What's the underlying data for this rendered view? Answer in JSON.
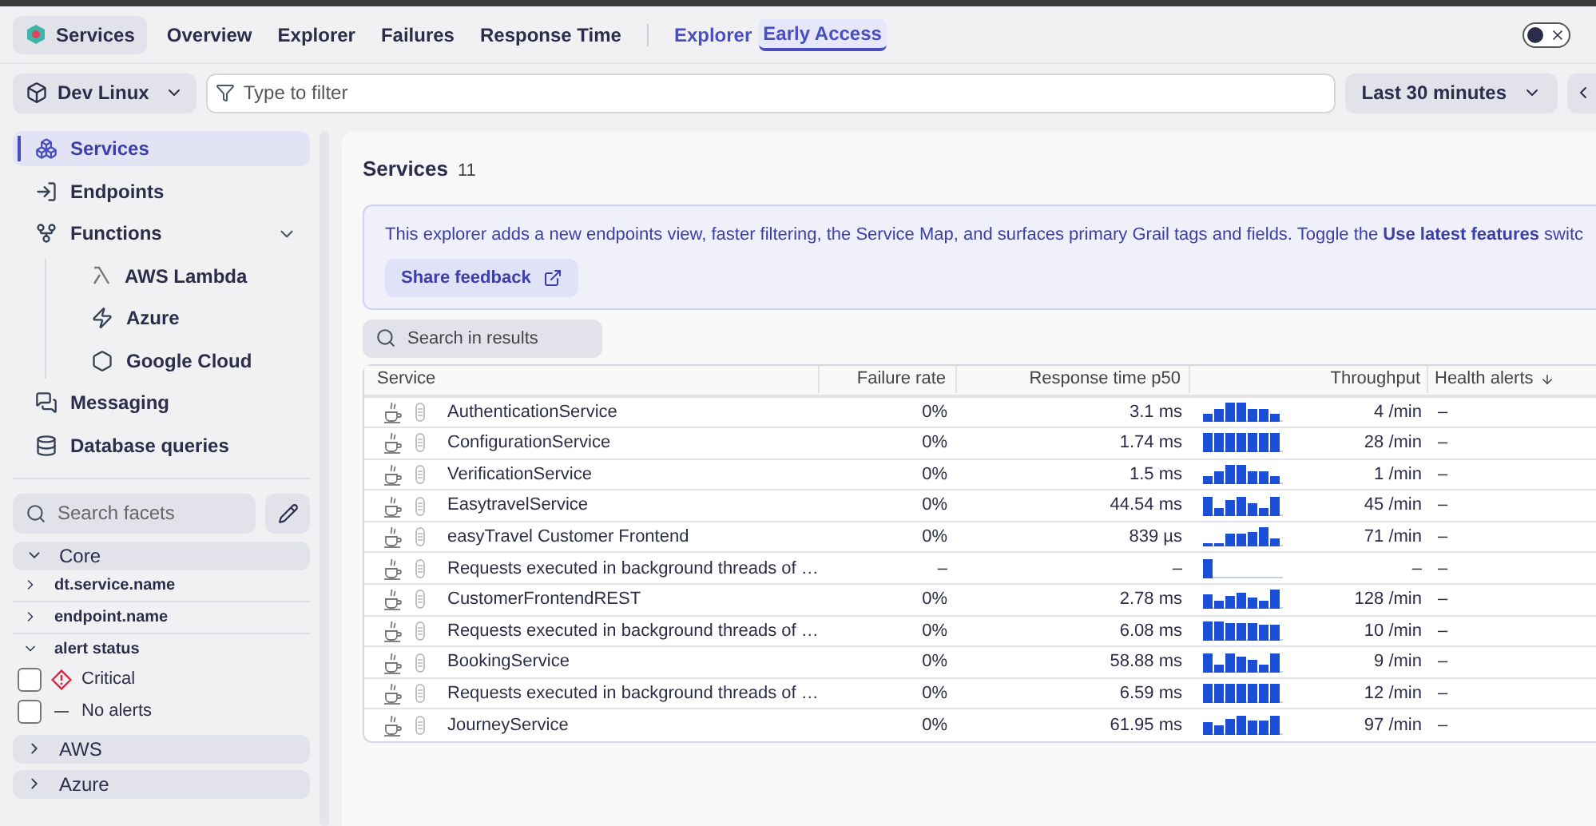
{
  "app_button": {
    "label": "Services"
  },
  "tabs": [
    {
      "label": "Overview",
      "selected": false
    },
    {
      "label": "Explorer",
      "selected": false
    },
    {
      "label": "Failures",
      "selected": false
    },
    {
      "label": "Response Time",
      "selected": false
    },
    {
      "label": "Explorer",
      "badge": "Early Access",
      "selected": true
    }
  ],
  "toggle": {
    "on": false
  },
  "filter_bar": {
    "environment": "Dev Linux",
    "placeholder": "Type to filter",
    "timeframe": "Last 30 minutes"
  },
  "sidebar": {
    "items": [
      {
        "label": "Services",
        "kind": "services",
        "selected": true
      },
      {
        "label": "Endpoints",
        "kind": "endpoints",
        "selected": false
      },
      {
        "label": "Functions",
        "kind": "functions",
        "selected": false,
        "expanded": true,
        "children": [
          {
            "label": "AWS Lambda",
            "kind": "lambda",
            "selected": false
          },
          {
            "label": "Azure",
            "kind": "azure",
            "selected": false
          },
          {
            "label": "Google Cloud",
            "kind": "gcloud",
            "selected": false
          }
        ]
      },
      {
        "label": "Messaging",
        "kind": "messaging",
        "selected": false
      },
      {
        "label": "Database queries",
        "kind": "database",
        "selected": false
      }
    ],
    "facet_search": {
      "placeholder": "Search facets"
    },
    "facet_groups": [
      {
        "label": "Core",
        "expanded": true,
        "facets": [
          {
            "label": "dt.service.name",
            "expanded": false
          },
          {
            "label": "endpoint.name",
            "expanded": false
          },
          {
            "label": "alert status",
            "expanded": true,
            "options": [
              {
                "label": "Critical",
                "kind": "critical",
                "checked": false
              },
              {
                "label": "No alerts",
                "kind": "none",
                "checked": false
              }
            ]
          }
        ]
      },
      {
        "label": "AWS",
        "expanded": false
      },
      {
        "label": "Azure",
        "expanded": false
      }
    ]
  },
  "main": {
    "title": "Services",
    "count": "11",
    "notice": {
      "text": "This explorer adds a new endpoints view, faster filtering, the Service Map, and surfaces primary Grail tags and fields. Toggle the **Use latest features** switc",
      "button": "Share feedback"
    },
    "search": {
      "placeholder": "Search in results"
    },
    "table": {
      "columns": [
        "Service",
        "Failure rate",
        "Response time p50",
        "Throughput",
        "Health alerts"
      ],
      "rows": [
        {
          "service": "AuthenticationService",
          "failure_rate": "0%",
          "response_time": "3.1 ms",
          "throughput": "4 /min",
          "health_alerts": "–"
        },
        {
          "service": "ConfigurationService",
          "failure_rate": "0%",
          "response_time": "1.74 ms",
          "throughput": "28 /min",
          "health_alerts": "–"
        },
        {
          "service": "VerificationService",
          "failure_rate": "0%",
          "response_time": "1.5 ms",
          "throughput": "1 /min",
          "health_alerts": "–"
        },
        {
          "service": "EasytravelService",
          "failure_rate": "0%",
          "response_time": "44.54 ms",
          "throughput": "45 /min",
          "health_alerts": "–"
        },
        {
          "service": "easyTravel Customer Frontend",
          "failure_rate": "0%",
          "response_time": "839 µs",
          "throughput": "71 /min",
          "health_alerts": "–"
        },
        {
          "service": "Requests executed in background threads of …",
          "failure_rate": "–",
          "response_time": "–",
          "throughput": "–",
          "health_alerts": "–"
        },
        {
          "service": "CustomerFrontendREST",
          "failure_rate": "0%",
          "response_time": "2.78 ms",
          "throughput": "128 /min",
          "health_alerts": "–"
        },
        {
          "service": "Requests executed in background threads of …",
          "failure_rate": "0%",
          "response_time": "6.08 ms",
          "throughput": "10 /min",
          "health_alerts": "–"
        },
        {
          "service": "BookingService",
          "failure_rate": "0%",
          "response_time": "58.88 ms",
          "throughput": "9 /min",
          "health_alerts": "–"
        },
        {
          "service": "Requests executed in background threads of …",
          "failure_rate": "0%",
          "response_time": "6.59 ms",
          "throughput": "12 /min",
          "health_alerts": "–"
        },
        {
          "service": "JourneyService",
          "failure_rate": "0%",
          "response_time": "61.95 ms",
          "throughput": "97 /min",
          "health_alerts": "–"
        }
      ]
    }
  }
}
